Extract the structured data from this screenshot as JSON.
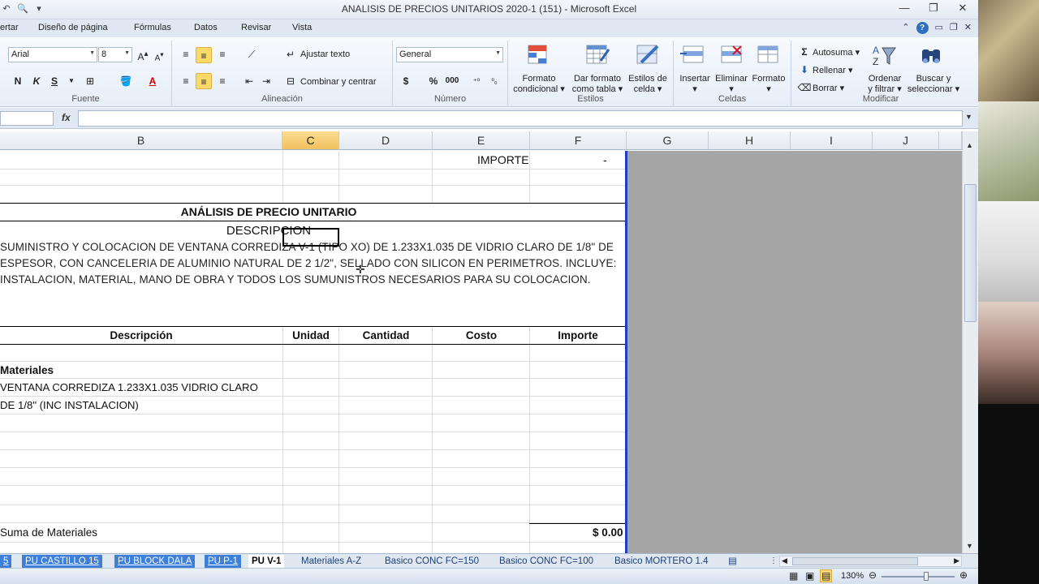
{
  "window": {
    "title": "ANALISIS DE PRECIOS UNITARIOS 2020-1 (151)  -  Microsoft Excel",
    "min": "▭",
    "restore": "❐",
    "close": "✕"
  },
  "ribbon_tabs": [
    "ertar",
    "Diseño de página",
    "Fórmulas",
    "Datos",
    "Revisar",
    "Vista"
  ],
  "ribbon": {
    "font": {
      "name": "Arial",
      "size": "8",
      "group_label": "Fuente",
      "bold": "N",
      "italic": "K",
      "underline": "S"
    },
    "alignment": {
      "wrap": "Ajustar texto",
      "merge": "Combinar y centrar",
      "group_label": "Alineación"
    },
    "number": {
      "format": "General",
      "group_label": "Número",
      "currency": "$",
      "percent": "%",
      "thousands": "000"
    },
    "styles": {
      "cond": [
        "Formato",
        "condicional"
      ],
      "table": [
        "Dar formato",
        "como tabla"
      ],
      "cell": [
        "Estilos de",
        "celda"
      ],
      "group_label": "Estilos"
    },
    "cells": {
      "insert": "Insertar",
      "delete": "Eliminar",
      "format": "Formato",
      "group_label": "Celdas"
    },
    "modify": {
      "autosum": "Autosuma",
      "fill": "Rellenar",
      "clear": "Borrar",
      "sort": [
        "Ordenar",
        "y filtrar"
      ],
      "find": [
        "Buscar y",
        "seleccionar"
      ],
      "group_label": "Modificar"
    }
  },
  "formula_bar": {
    "fx": "fx"
  },
  "columns": [
    {
      "label": "B",
      "selected": false
    },
    {
      "label": "C",
      "selected": true
    },
    {
      "label": "D",
      "selected": false
    },
    {
      "label": "E",
      "selected": false
    },
    {
      "label": "F",
      "selected": false
    },
    {
      "label": "G",
      "selected": false
    },
    {
      "label": "H",
      "selected": false
    },
    {
      "label": "I",
      "selected": false
    },
    {
      "label": "J",
      "selected": false
    }
  ],
  "sheet": {
    "importe_label": "IMPORTE",
    "importe_value": "-",
    "title": "ANÁLISIS DE PRECIO UNITARIO",
    "subtitle": "DESCRIPCION",
    "description_lines": [
      "SUMINISTRO Y COLOCACION DE VENTANA CORREDIZA V-1 (TIPO XO) DE 1.233X1.035 DE VIDRIO CLARO DE 1/8\" DE",
      "ESPESOR, CON  CANCELERIA DE ALUMINIO NATURAL DE 2 1/2\", SELLADO CON SILICON EN PERIMETROS. INCLUYE:",
      "INSTALACION, MATERIAL,  MANO DE OBRA Y TODOS LOS SUMUNISTROS NECESARIOS PARA SU COLOCACION."
    ],
    "headers": [
      "Descripción",
      "Unidad",
      "Cantidad",
      "Costo",
      "Importe"
    ],
    "section": "Materiales",
    "item_line1": "VENTANA CORREDIZA 1.233X1.035 VIDRIO CLARO",
    "item_line2": "DE 1/8\" (INC INSTALACION)",
    "sum_label": "Suma de Materiales",
    "sum_value": "$ 0.00"
  },
  "sheet_tabs": [
    {
      "label": "5",
      "style": "blue"
    },
    {
      "label": "PU CASTILLO 15",
      "style": "blue"
    },
    {
      "label": "PU BLOCK DALA",
      "style": "blue"
    },
    {
      "label": "PU P-1",
      "style": "blue"
    },
    {
      "label": "PU V-1",
      "style": "active"
    },
    {
      "label": "Materiales A-Z",
      "style": "plain"
    },
    {
      "label": "Basico CONC FC=150",
      "style": "plain"
    },
    {
      "label": "Basico CONC FC=100",
      "style": "plain"
    },
    {
      "label": "Basico MORTERO 1.4",
      "style": "plain"
    }
  ],
  "status": {
    "zoom": "130%"
  }
}
